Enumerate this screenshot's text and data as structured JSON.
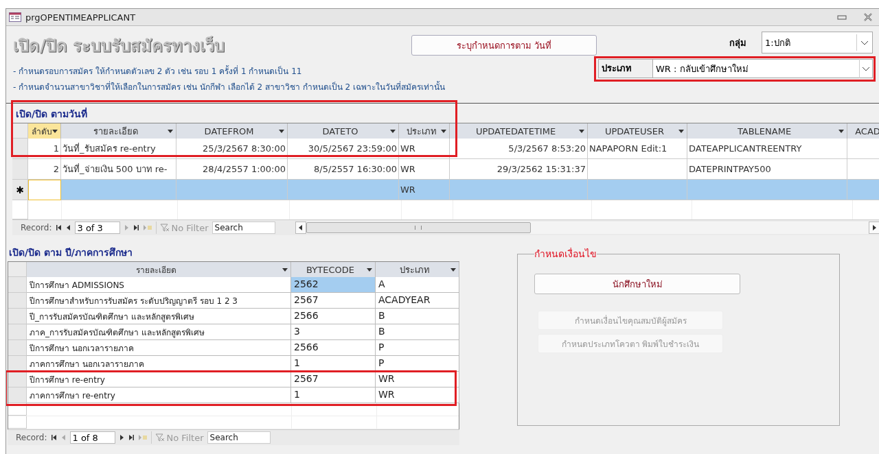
{
  "window": {
    "title": "prgOPENTIMEAPPLICANT"
  },
  "heading": "เปิด/ปิด ระบบรับสมัครทางเว็บ",
  "schedule_button": "ระบุกำหนดการตาม วันที่",
  "group": {
    "label": "กลุ่ม",
    "value": "1:ปกติ"
  },
  "type": {
    "label": "ประเภท",
    "value": "WR : กลับเข้าศึกษาใหม่"
  },
  "notes": [
    "- กำหนดรอบการสมัคร ให้กำหนดตัวเลข 2 ตัว เช่น รอบ 1 ครั้งที่ 1 กำหนดเป็น 11",
    "- กำหนดจำนวนสาขาวิชาที่ให้เลือกในการสมัคร เช่น นักกีฬา เลือกได้ 2 สาขาวิชา กำหนดเป็น 2 เฉพาะในวันที่สมัครเท่านั้น"
  ],
  "date_section": {
    "title": "เปิด/ปิด ตามวันที่",
    "columns": [
      {
        "label": "ลำดับ",
        "selected": true
      },
      {
        "label": "รายละเอียด",
        "selected": false
      },
      {
        "label": "DATEFROM",
        "selected": false
      },
      {
        "label": "DATETO",
        "selected": false
      },
      {
        "label": "ประเภท",
        "selected": false
      },
      {
        "label": "UPDATEDATETIME",
        "selected": false
      },
      {
        "label": "UPDATEUSER",
        "selected": false
      },
      {
        "label": "TABLENAME",
        "selected": false
      },
      {
        "label": "ACAD",
        "selected": false
      }
    ],
    "rows": [
      {
        "kind": "record",
        "selected": false,
        "cells": [
          "1",
          "วันที่_รับสมัคร re-entry",
          "25/3/2567 8:30:00",
          "30/5/2567 23:59:00",
          "WR",
          "5/3/2567 8:53:20",
          "NAPAPORN Edit:1",
          "DATEAPPLICANTREENTRY",
          ""
        ]
      },
      {
        "kind": "record",
        "selected": false,
        "cells": [
          "2",
          "วันที่_จ่ายเงิน 500 บาท  re-",
          "28/4/2557 1:00:00",
          "8/5/2557 16:30:00",
          "WR",
          "29/3/2562 15:31:37",
          "",
          "DATEPRINTPAY500",
          ""
        ]
      },
      {
        "kind": "new",
        "selected": true,
        "marker": "✱",
        "cells": [
          "",
          "",
          "",
          "",
          "WR",
          "",
          "",
          "",
          ""
        ]
      }
    ],
    "navigator": {
      "label": "Record:",
      "position": "3 of 3",
      "filter": "No Filter",
      "search": "Search"
    }
  },
  "year_section": {
    "title": "เปิด/ปิด ตาม ปี/ภาคการศึกษา",
    "columns": [
      {
        "label": "รายละเอียด",
        "focused": false
      },
      {
        "label": "BYTECODE",
        "focused": true
      },
      {
        "label": "ประเภท",
        "focused": false
      }
    ],
    "rows": [
      {
        "selected": true,
        "cells": [
          "ปีการศึกษา ADMISSIONS",
          "2562",
          "A"
        ]
      },
      {
        "selected": false,
        "cells": [
          "ปีการศึกษาสำหรับการรับสมัคร ระดับปริญญาตรี รอบ 1 2 3",
          "2567",
          "ACADYEAR"
        ]
      },
      {
        "selected": false,
        "cells": [
          "ปี_การรับสมัครบัณฑิตศึกษา และหลักสูตรพิเศษ",
          "2566",
          "B"
        ]
      },
      {
        "selected": false,
        "cells": [
          "ภาค_การรับสมัครบัณฑิตศึกษา และหลักสูตรพิเศษ",
          "3",
          "B"
        ]
      },
      {
        "selected": false,
        "cells": [
          "ปีการศึกษา นอกเวลารายภาค",
          "2566",
          "P"
        ]
      },
      {
        "selected": false,
        "cells": [
          "ภาคการศึกษา นอกเวลารายภาค",
          "1",
          "P"
        ]
      },
      {
        "selected": false,
        "cells": [
          "ปีการศึกษา re-entry",
          "2567",
          "WR"
        ]
      },
      {
        "selected": false,
        "cells": [
          "ภาคการศึกษา re-entry",
          "1",
          "WR"
        ]
      }
    ],
    "navigator": {
      "label": "Record:",
      "position": "1 of 8",
      "filter": "No Filter",
      "search": "Search"
    }
  },
  "conditions": {
    "title": "กำหนดเงื่อนไข",
    "buttons": [
      {
        "label": "นักศึกษาใหม่",
        "disabled": false
      },
      {
        "label": "กำหนดเงื่อนไขคุณสมบัติผู้สมัคร",
        "disabled": true
      },
      {
        "label": "กำหนดประเภทโควตา พิมพ์ใบชำระเงิน",
        "disabled": true
      }
    ]
  }
}
